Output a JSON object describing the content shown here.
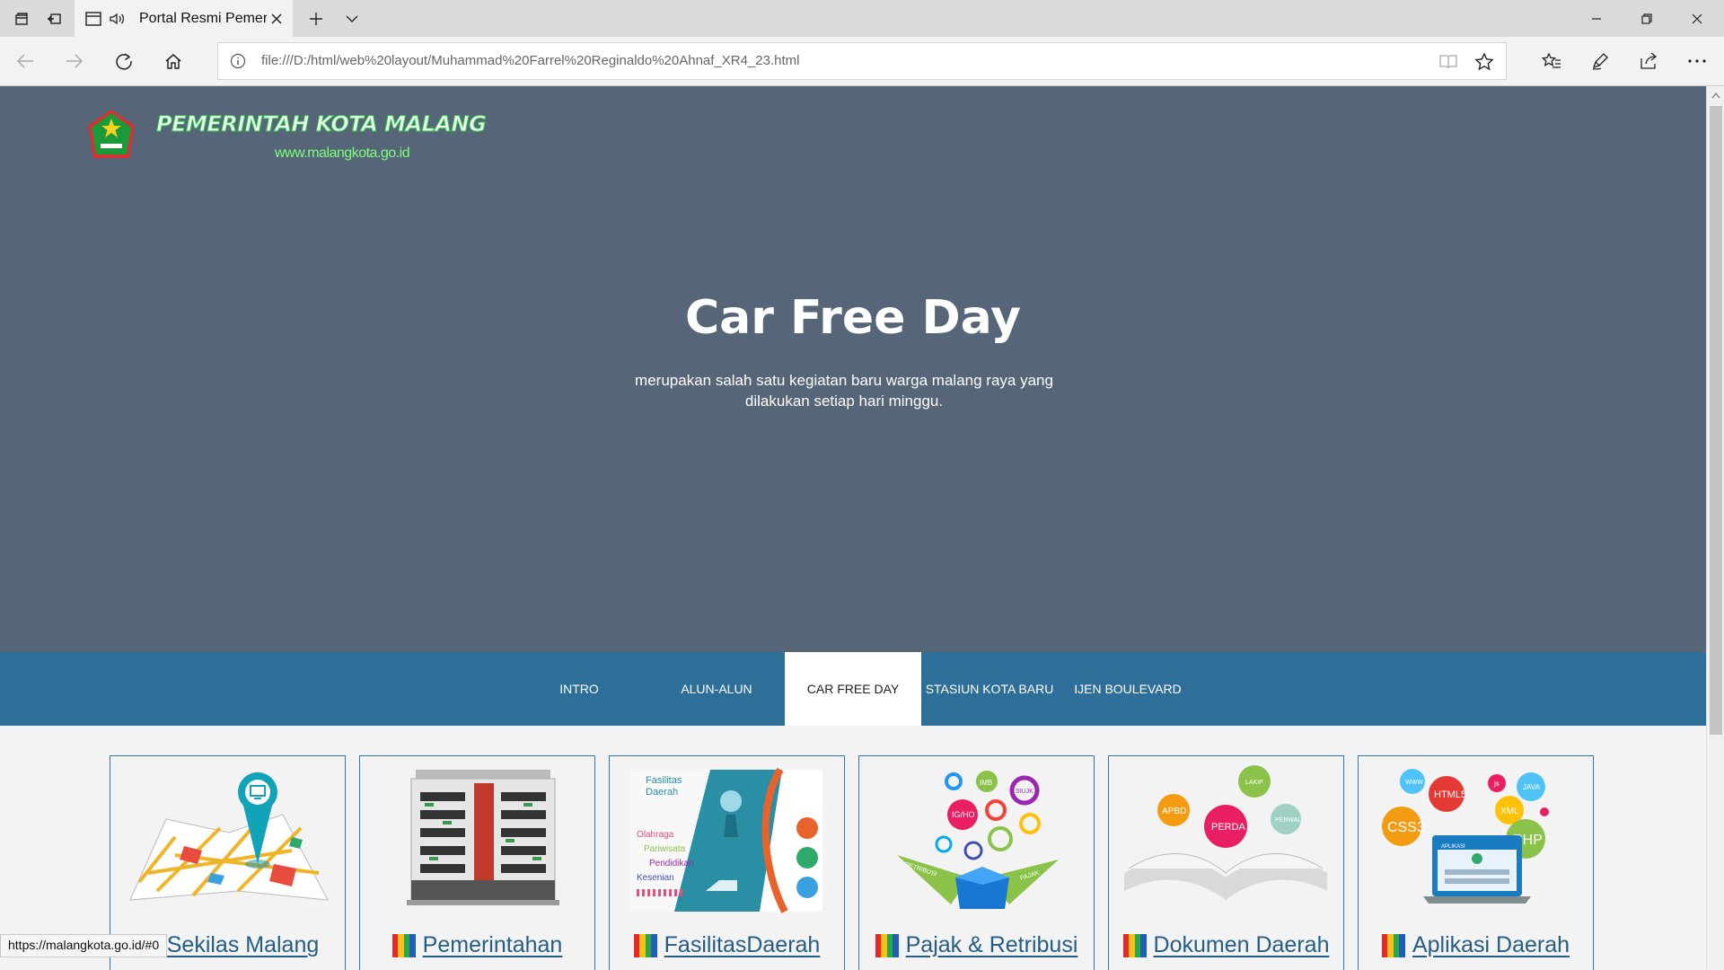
{
  "browser": {
    "tab_title": "Portal Resmi Pemer",
    "url": "file:///D:/html/web%20layout/Muhammad%20Farrel%20Reginaldo%20Ahnaf_XR4_23.html",
    "status_url": "https://malangkota.go.id/#0",
    "icons": [
      "tab-manager-icon",
      "set-aside-tabs-icon",
      "page-icon",
      "audio-icon",
      "close-icon",
      "new-tab-icon",
      "chevron-down-icon",
      "back-icon",
      "forward-icon",
      "refresh-icon",
      "home-icon",
      "info-icon",
      "reading-view-icon",
      "favorite-star-icon",
      "favorites-list-icon",
      "pen-icon",
      "share-icon",
      "more-icon",
      "minimize-icon",
      "restore-icon",
      "window-close-icon"
    ]
  },
  "header": {
    "logo_title": "PEMERINTAH KOTA MALANG",
    "logo_url": "www.malangkota.go.id"
  },
  "hero": {
    "title": "Car Free Day",
    "description": "merupakan salah satu kegiatan baru warga malang raya yang dilakukan setiap hari minggu."
  },
  "menu": {
    "items": [
      {
        "label": "INTRO"
      },
      {
        "label": "ALUN-ALUN"
      },
      {
        "label": "CAR FREE DAY"
      },
      {
        "label": "STASIUN KOTA BARU"
      },
      {
        "label": "IJEN BOULEVARD"
      }
    ],
    "active": "CAR FREE DAY"
  },
  "cards": [
    {
      "label": "Sekilas Malang"
    },
    {
      "label": "Pemerintahan"
    },
    {
      "label": "FasilitasDaerah",
      "image_text": [
        "Fasilitas",
        "Daerah",
        "Olahraga",
        "Pariwisata",
        "Pendidikan",
        "Kesenian"
      ]
    },
    {
      "label": "Pajak & Retribusi",
      "image_text": [
        "IMB",
        "SIUJK",
        "IG/HO",
        "RETRIBUSI",
        "PAJAK"
      ]
    },
    {
      "label": "Dokumen Daerah",
      "image_text": [
        "LAKIP",
        "APBD",
        "PERDA",
        "PERWAL"
      ]
    },
    {
      "label": "Aplikasi Daerah",
      "image_text": [
        "WWW",
        "HTML5",
        "js",
        "JAVA",
        "CSS3",
        "XML",
        "PHP",
        "APLIKASI"
      ]
    }
  ],
  "colors": {
    "hero_bg": "#566577",
    "menu_bg": "#2e6f9a",
    "card_border": "#2e79b5",
    "card_text": "#245d86",
    "flag": [
      "#e8262b",
      "#f6c21a",
      "#2aa84a",
      "#1f5fb5"
    ]
  }
}
